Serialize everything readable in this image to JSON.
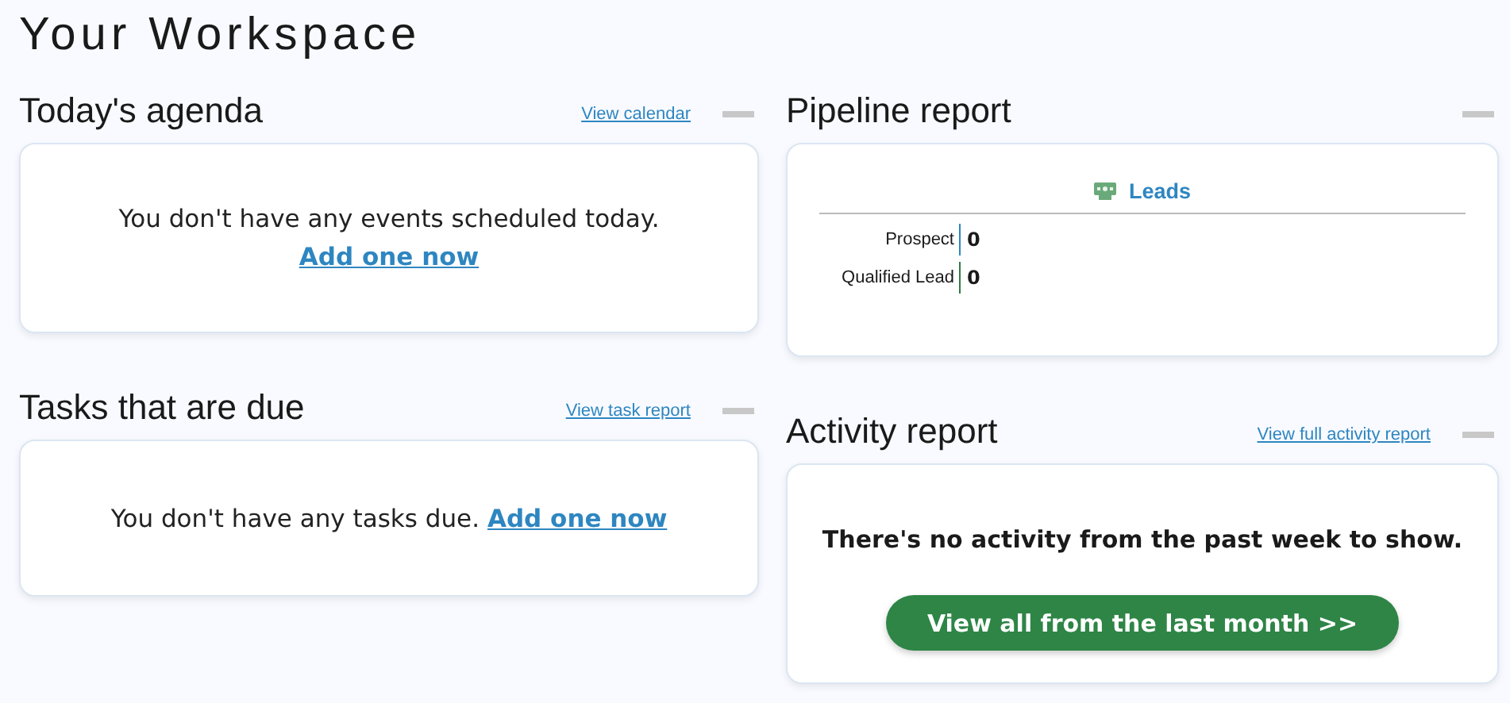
{
  "page_title": "Your Workspace",
  "columns": [
    [
      {
        "kind": "empty",
        "title": "Today's agenda",
        "link": "View calendar",
        "message": "You don't have any events scheduled today.",
        "action": "Add one now"
      },
      {
        "kind": "empty",
        "title": "Tasks that are due",
        "link": "View task report",
        "message": "You don't have any tasks due.",
        "action": "Add one now"
      }
    ],
    [
      {
        "kind": "pipeline",
        "title": "Pipeline report",
        "section": "Leads",
        "rows": [
          {
            "label": "Prospect",
            "value": "0",
            "color": "#2e86c1"
          },
          {
            "label": "Qualified Lead",
            "value": "0",
            "color": "#2e7d46"
          }
        ]
      },
      {
        "kind": "activity",
        "title": "Activity report",
        "link": "View full activity report",
        "message": "There's no activity from the past week to show.",
        "button": "View all from the last month >>"
      }
    ]
  ]
}
